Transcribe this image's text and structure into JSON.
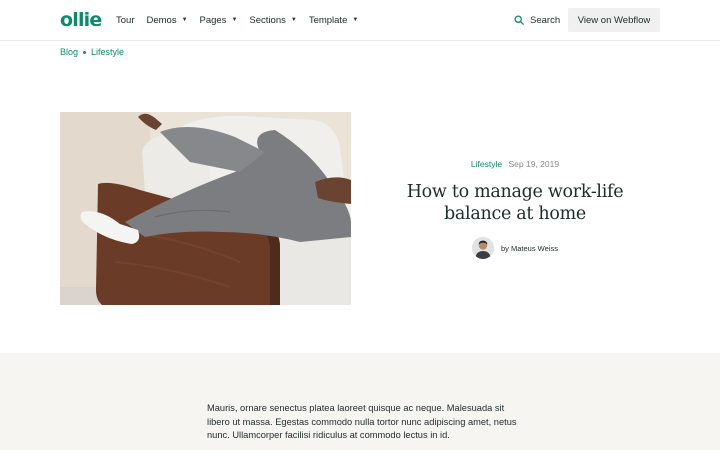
{
  "header": {
    "logo": "ollie",
    "nav": [
      {
        "label": "Tour",
        "has_dropdown": false
      },
      {
        "label": "Demos",
        "has_dropdown": true
      },
      {
        "label": "Pages",
        "has_dropdown": true
      },
      {
        "label": "Sections",
        "has_dropdown": true
      },
      {
        "label": "Template",
        "has_dropdown": true
      }
    ],
    "search_label": "Search",
    "cta_label": "View on Webflow"
  },
  "breadcrumb": [
    "Blog",
    "Lifestyle"
  ],
  "article": {
    "category": "Lifestyle",
    "date": "Sep 19, 2019",
    "title": "How to manage work-life balance at home",
    "author": "by Mateus Weiss"
  },
  "body": {
    "paragraph": "Mauris, ornare senectus platea laoreet quisque ac neque. Malesuada sit libero ut massa. Egestas commodo nulla tortor nunc adipiscing amet, netus nunc. Ullamcorper facilisi ridiculus at commodo lectus in id."
  },
  "colors": {
    "accent": "#0e8a6b",
    "text": "#1f2a2a",
    "muted": "#8c8c8c",
    "section_bg": "#f6f5f2"
  }
}
